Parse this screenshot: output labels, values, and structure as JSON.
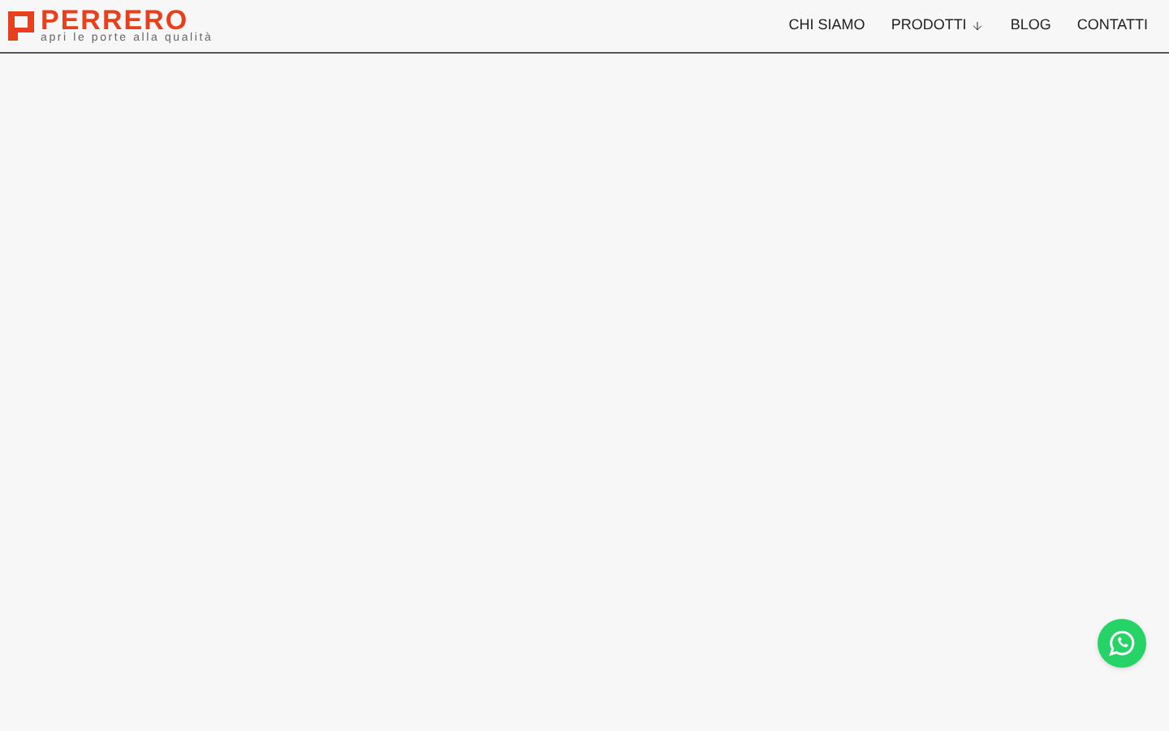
{
  "logo": {
    "name": "PERRERO",
    "tagline": "apri le porte alla qualità"
  },
  "nav": [
    {
      "label": "CHI SIAMO",
      "dropdown": false
    },
    {
      "label": "PRODOTTI",
      "dropdown": true
    },
    {
      "label": "BLOG",
      "dropdown": false
    },
    {
      "label": "CONTATTI",
      "dropdown": false
    }
  ]
}
